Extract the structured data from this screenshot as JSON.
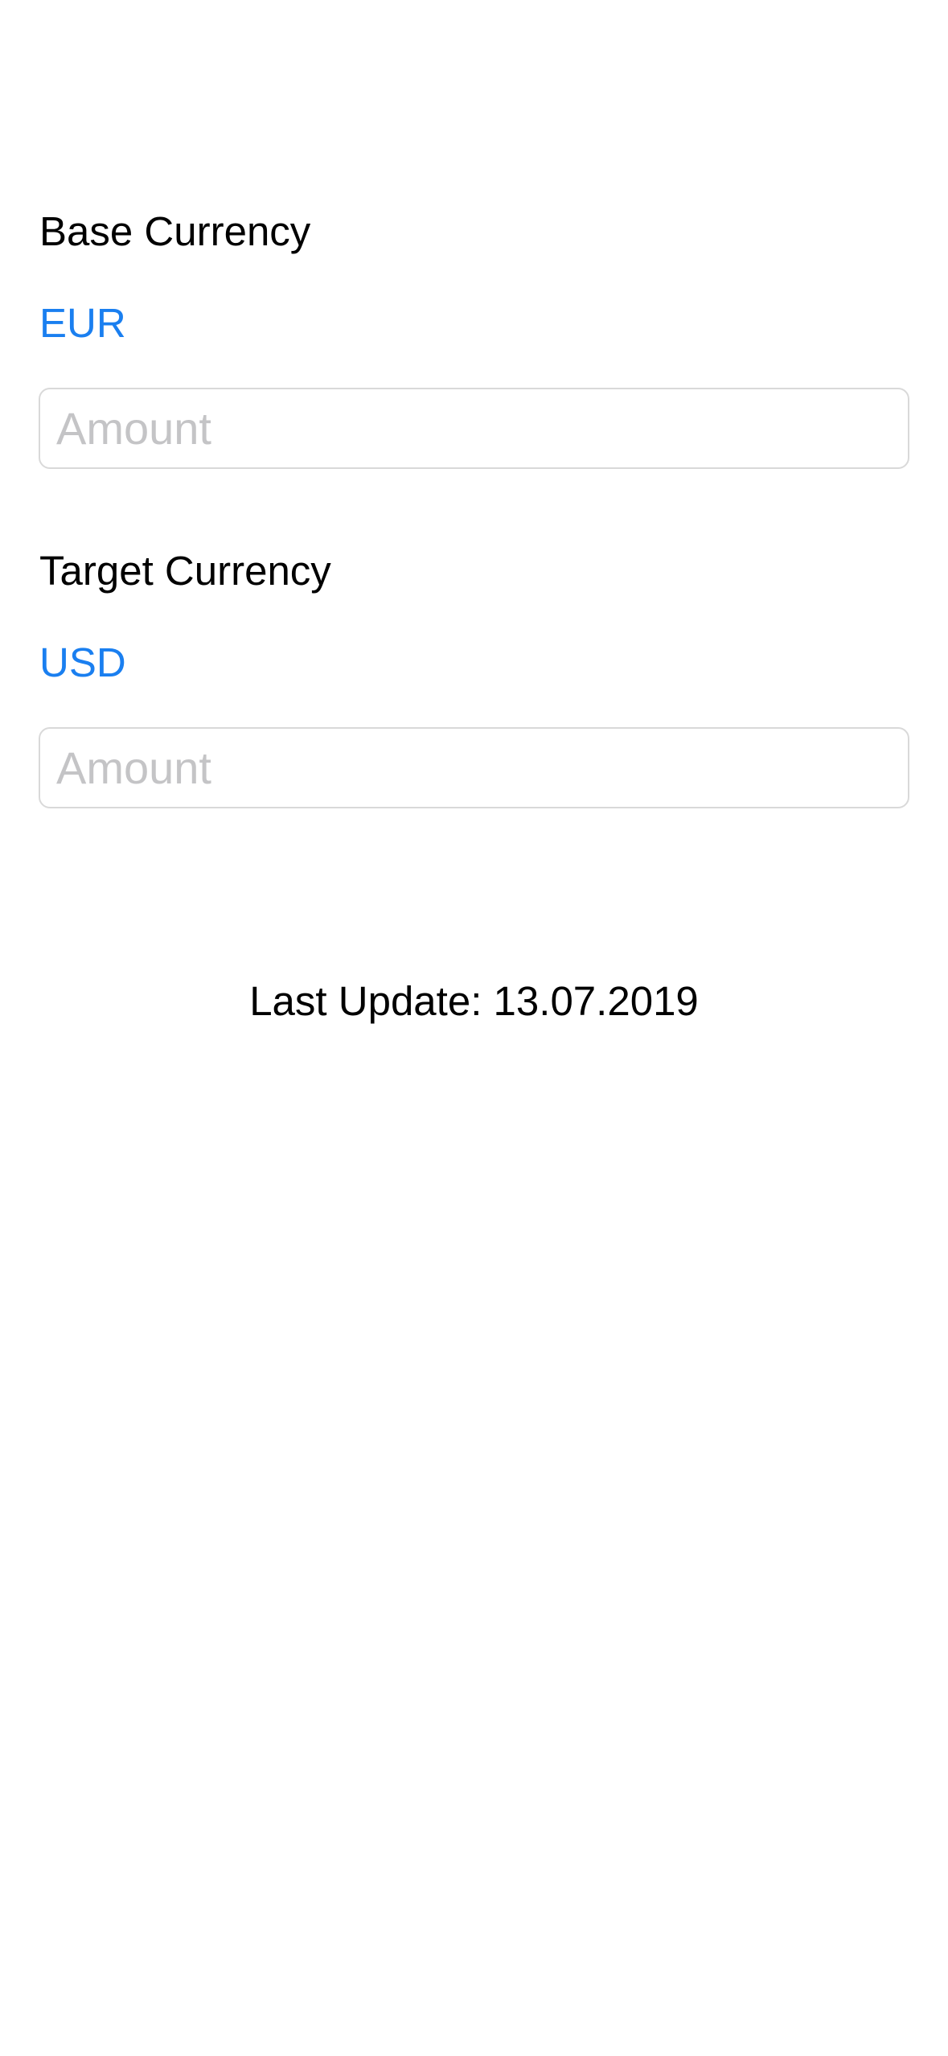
{
  "base": {
    "label": "Base Currency",
    "currency": "EUR",
    "amount_placeholder": "Amount",
    "amount_value": ""
  },
  "target": {
    "label": "Target Currency",
    "currency": "USD",
    "amount_placeholder": "Amount",
    "amount_value": ""
  },
  "footer": {
    "last_update": "Last Update: 13.07.2019"
  },
  "colors": {
    "accent": "#1a7ff0",
    "text": "#000000",
    "placeholder": "#c4c4c6",
    "input_border": "#d9d9d9",
    "background": "#ffffff"
  }
}
